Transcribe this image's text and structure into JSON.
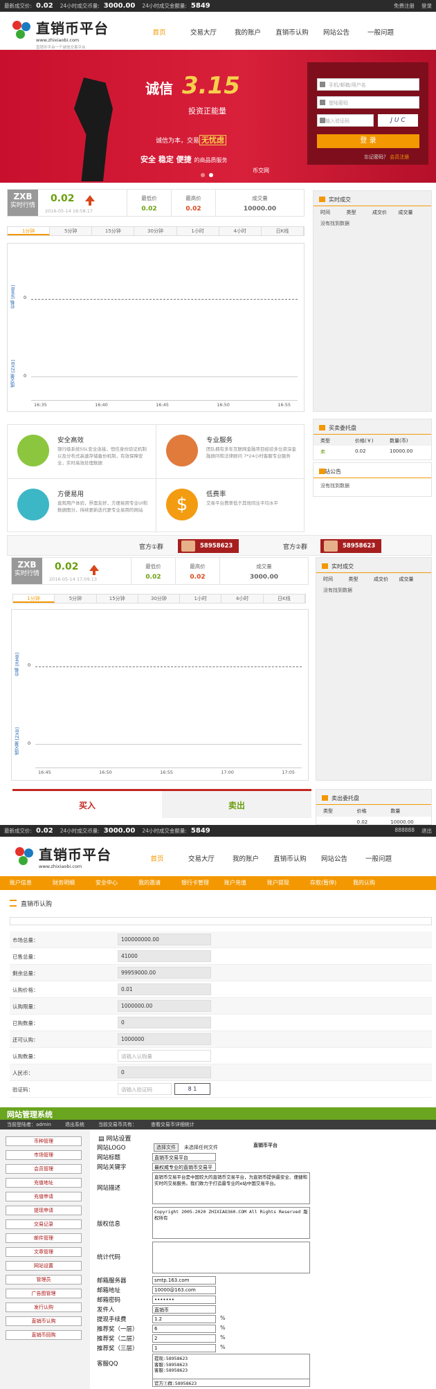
{
  "topbar1": {
    "l1": "最新成交价:",
    "v1": "0.02",
    "l2": "24小时成交币量:",
    "v2": "3000.00",
    "l3": "24小时成交金额量:",
    "v3": "5849",
    "register": "免费注册",
    "login": "登录"
  },
  "topbar2": {
    "l1": "最新成交价:",
    "v1": "0.02",
    "l2": "24小时成交币量:",
    "v2": "3000.00",
    "l3": "24小时成交金额量:",
    "v3": "5849",
    "user": "888888",
    "logout": "退出"
  },
  "logo": {
    "name": "直销币平台",
    "url": "www.zhixiaobi.com",
    "slogan": "直销币平台一个诚信交易平台"
  },
  "nav": [
    "首页",
    "交易大厅",
    "我的账户",
    "直销币认购",
    "网站公告",
    "一般问题"
  ],
  "hero": {
    "t1": "诚信",
    "t2": "3.15",
    "t3": "投资正能量",
    "t4": "诚信为本，交易",
    "t4b": "无忧虑",
    "t5": "安全 稳定 便捷",
    "t5b": "的商品质服务",
    "t6": "币交网"
  },
  "login": {
    "user_ph": "手机/邮箱/用户名",
    "pass_ph": "登陆密码",
    "code_ph": "请输入验证码",
    "captcha": "J U C",
    "button": "登 录",
    "forgot": "忘记密码？",
    "register": "会员注册"
  },
  "ticker1": {
    "name": "ZXB",
    "sub": "实时行情",
    "price": "0.02",
    "time": "2016-05-14 16:58:17",
    "low_l": "最低价",
    "low": "0.02",
    "high_l": "最高价",
    "high": "0.02",
    "vol_l": "成交量",
    "vol": "10000.00"
  },
  "ticker2": {
    "name": "ZXB",
    "sub": "实时行情",
    "price": "0.02",
    "time": "2016-05-14 17:09:13",
    "low_l": "最低价",
    "low": "0.02",
    "high_l": "最高价",
    "high": "0.02",
    "vol_l": "成交量",
    "vol": "3000.00"
  },
  "tabs": [
    "1分钟",
    "5分钟",
    "15分钟",
    "30分钟",
    "1小时",
    "4小时",
    "日K线"
  ],
  "chart1": {
    "y1": "价格 [RMB]",
    "y2": "成交量 [ZXB]",
    "zero": "0",
    "times": [
      "16:35",
      "16:40",
      "16:45",
      "16:50",
      "16:55"
    ]
  },
  "chart2": {
    "y1": "价格 [RMB]",
    "y2": "成交量 [ZXB]",
    "zero": "0",
    "times": [
      "16:45",
      "16:50",
      "16:55",
      "17:00",
      "17:05"
    ]
  },
  "trades": {
    "title": "实时成交",
    "cols": [
      "时间",
      "类型",
      "成交价",
      "成交量"
    ],
    "empty": "没有找到数据"
  },
  "sellbook": {
    "title": "买卖委托盘",
    "cols": [
      "类型",
      "价格(￥)",
      "数量(币)"
    ],
    "type": "卖",
    "price": "0.02",
    "qty": "10000.00"
  },
  "notice": {
    "title": "网站公告",
    "empty": "没有找到数据"
  },
  "features": [
    {
      "title": "安全高效",
      "desc": "银行级系统SSL安全连接，恒信身份验证机制以及分布式高速存储备份机制，有效保障安全，实时高效处理数据"
    },
    {
      "title": "专业服务",
      "desc": "团队拥有多年互联网金融项目经验多位资深金融顾问和法律顾问 7*24小时客服专业服务"
    },
    {
      "title": "方便易用",
      "desc": "直观用户体验，界面友好，方便易用专业UI和数据图分，持续更新迭代更专业易用的网站"
    },
    {
      "title": "低费率",
      "desc": "交易平台费率低于其他同业平均水平"
    }
  ],
  "qq": {
    "g1": "官方①群",
    "n1": "58958623",
    "g2": "官方②群",
    "n2": "58958623"
  },
  "buysell": {
    "buy": "买入",
    "sell": "卖出"
  },
  "sellbook2": {
    "title": "卖出委托盘",
    "cols": [
      "类型",
      "价格",
      "数量"
    ],
    "price": "0.02",
    "qty": "10000.00"
  },
  "menu2": [
    "账户信息",
    "财务明细",
    "安全中心",
    "我的邀请",
    "银行卡管理",
    "账户充值",
    "账户提现",
    "存款(暂停)",
    "我的认购"
  ],
  "subscribe": {
    "title": "直销币认购",
    "rows": [
      {
        "k": "市场总量：",
        "v": "100000000.00"
      },
      {
        "k": "已售总量：",
        "v": "41000"
      },
      {
        "k": "剩余总量：",
        "v": "99959000.00"
      },
      {
        "k": "认购价格：",
        "v": "0.01"
      },
      {
        "k": "认购限量：",
        "v": "1000000.00"
      },
      {
        "k": "已购数量：",
        "v": "0"
      },
      {
        "k": "还可认购：",
        "v": "1000000"
      },
      {
        "k": "认购数量：",
        "v": "请输入认购量"
      },
      {
        "k": "人民币：",
        "v": "0"
      },
      {
        "k": "验证码：",
        "v": "请输入验证码"
      }
    ],
    "captcha": "8  1"
  },
  "admin": {
    "title": "网站管理系统",
    "admin_l": "当前登陆者：",
    "admin": "admin",
    "logout": "退出系统",
    "info": "当前交易币共有：",
    "detail": "查看交易币详细统计",
    "menu": [
      "币种管理",
      "市场管理",
      "会员管理",
      "充值地址",
      "充值申请",
      "提现申请",
      "交易记录",
      "邮件管理",
      "文章管理",
      "网站设置",
      "管理员",
      "广告图管理",
      "发行认购",
      "直销币认购",
      "直销币回购"
    ],
    "section": "网站设置",
    "logo_l": "网站LOGO",
    "choose": "选择文件",
    "nofile": "未选择任何文件",
    "logo_prev": "直销币平台",
    "t_l": "网站标题",
    "t": "直销币交易平台",
    "kw_l": "网站关键字",
    "kw": "最权威专业的直销币交易平台",
    "desc_l": "网站描述",
    "desc": "直销币交易平台是中国较大的直销币交易平台，为直销币提供最安全、便捷和实时的交易服务。我们致力于打造最专业的e站中国交易平台。",
    "copy_l": "版权信息",
    "copy": "Copyright 2005-2020 ZHIXIAO360.COM All Rights Reserved 版权所有",
    "stat_l": "统计代码",
    "smtp_l": "邮箱服务器",
    "smtp": "smtp.163.com",
    "mail_l": "邮箱地址",
    "mail": "10000@163.com",
    "mpw_l": "邮箱密码",
    "mpw": "•••••••",
    "sender_l": "发件人",
    "sender": "直销币",
    "fee_l": "提现手续费",
    "fee": "1.2",
    "r1_l": "推荐奖（一层）",
    "r1": "6",
    "r2_l": "推荐奖（二层）",
    "r2": "2",
    "r3_l": "推荐奖（三层）",
    "r3": "1",
    "pct": "%",
    "kf_l": "客服QQ",
    "kf": "提现:58958623\n客服:58958623\n客服:58958623",
    "qg": "官方①群:58958623"
  }
}
